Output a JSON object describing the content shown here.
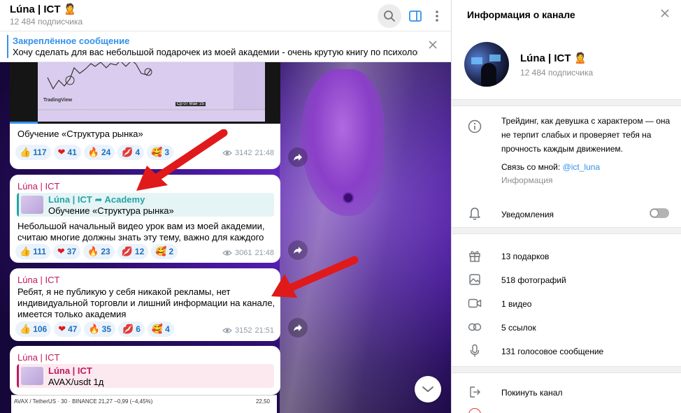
{
  "chat": {
    "title": "Lúna | ICT 🙎",
    "subscribers": "12 484 подписчика",
    "pinned": {
      "title": "Закреплённое сообщение",
      "text": "Хочу сделать для вас небольшой подарочек из моей академии - очень крутую книгу по психологии..."
    },
    "messages": [
      {
        "video_caption": "Обучение «Структура рынка»",
        "chart_brand": "TradingView",
        "chart_date": "Ср 07 Май '25",
        "reactions": [
          {
            "emoji": "👍",
            "count": "117"
          },
          {
            "emoji": "❤",
            "count": "41"
          },
          {
            "emoji": "🔥",
            "count": "24"
          },
          {
            "emoji": "💋",
            "count": "4"
          },
          {
            "emoji": "🥰",
            "count": "3"
          }
        ],
        "views": "3142",
        "time": "21:48"
      },
      {
        "author": "Lúna | ICT",
        "reply_name": "Lúna | ICT ➦ Academy",
        "reply_text": "Обучение «Структура рынка»",
        "text_lines": [
          "Небольшой начальный видео урок вам из моей академии,",
          "считаю многие должны знать эту тему, важно для каждого"
        ],
        "reactions": [
          {
            "emoji": "👍",
            "count": "111"
          },
          {
            "emoji": "❤",
            "count": "37"
          },
          {
            "emoji": "🔥",
            "count": "23"
          },
          {
            "emoji": "💋",
            "count": "12"
          },
          {
            "emoji": "🥰",
            "count": "2"
          }
        ],
        "views": "3061",
        "time": "21:48"
      },
      {
        "author": "Lúna | ICT",
        "text_lines": [
          "Ребят, я не публикую у себя никакой рекламы, нет",
          "индивидуальной торговли и лишний информации на канале,",
          "имеется только академия"
        ],
        "reactions": [
          {
            "emoji": "👍",
            "count": "106"
          },
          {
            "emoji": "❤",
            "count": "47"
          },
          {
            "emoji": "🔥",
            "count": "35"
          },
          {
            "emoji": "💋",
            "count": "6"
          },
          {
            "emoji": "🥰",
            "count": "4"
          }
        ],
        "views": "3152",
        "time": "21:51"
      },
      {
        "author": "Lúna | ICT",
        "reply_name": "Lúna | ICT",
        "reply_text": "AVAX/usdt 1д",
        "chart_label": "AVAX / TetherUS · 30 · BINANCE  21,27  −0,99 (−4,45%)",
        "chart_price": "22,50"
      }
    ]
  },
  "info": {
    "title": "Информация о канале",
    "name": "Lúna | ICT 🙎",
    "subscribers": "12 484 подписчика",
    "about": "Трейдинг, как девушка с характером — она не терпит слабых и проверяет тебя на прочность каждым движением.",
    "contact_prefix": "Связь со мной: ",
    "contact_link": "@ict_luna",
    "contact_sub": "Информация",
    "notifications": "Уведомления",
    "notifications_on": false,
    "stats": [
      {
        "icon": "gift-icon",
        "label": "13 подарков"
      },
      {
        "icon": "photo-icon",
        "label": "518 фотографий"
      },
      {
        "icon": "video-icon",
        "label": "1 видео"
      },
      {
        "icon": "link-icon",
        "label": "5 ссылок"
      },
      {
        "icon": "microphone-icon",
        "label": "131 голосовое сообщение"
      }
    ],
    "leave": "Покинуть канал"
  },
  "colors": {
    "accent": "#3390ec",
    "author": "#c2185b",
    "arrow": "#e0191b",
    "reaction_bg": "#eaf2fb"
  }
}
